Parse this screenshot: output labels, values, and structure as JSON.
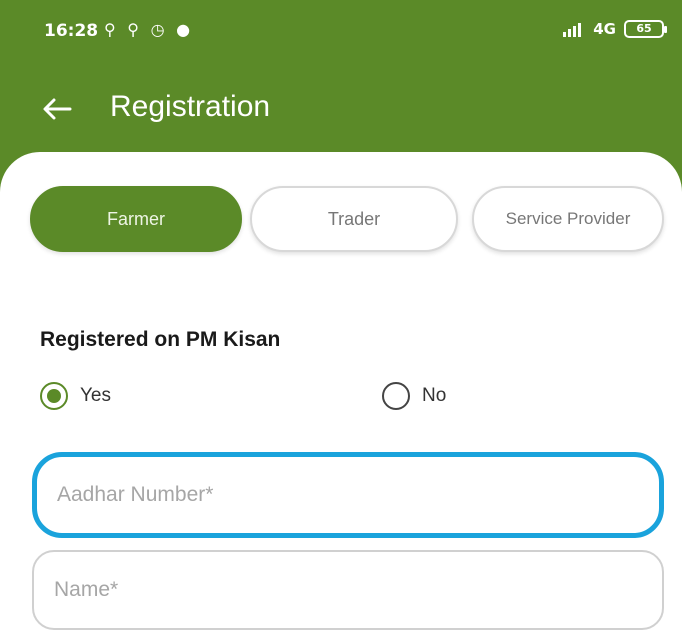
{
  "status_bar": {
    "time": "16:28",
    "notification_icons": "⚲ ⚲ ◷ ●",
    "network": "4G",
    "battery": "65"
  },
  "header": {
    "title": "Registration",
    "back_icon": "arrow-left-icon",
    "background_color": "#5b8a28"
  },
  "tabs": [
    {
      "label": "Farmer",
      "active": true
    },
    {
      "label": "Trader",
      "active": false
    },
    {
      "label": "Service Provider",
      "active": false
    }
  ],
  "pm_kisan": {
    "label": "Registered on PM Kisan",
    "options": [
      {
        "label": "Yes",
        "selected": true
      },
      {
        "label": "No",
        "selected": false
      }
    ]
  },
  "form": {
    "aadhar": {
      "placeholder": "Aadhar Number*",
      "value": ""
    },
    "name": {
      "placeholder": "Name*",
      "value": ""
    }
  },
  "colors": {
    "accent": "#5b8a28",
    "focus_outline": "#1aa3dc"
  }
}
